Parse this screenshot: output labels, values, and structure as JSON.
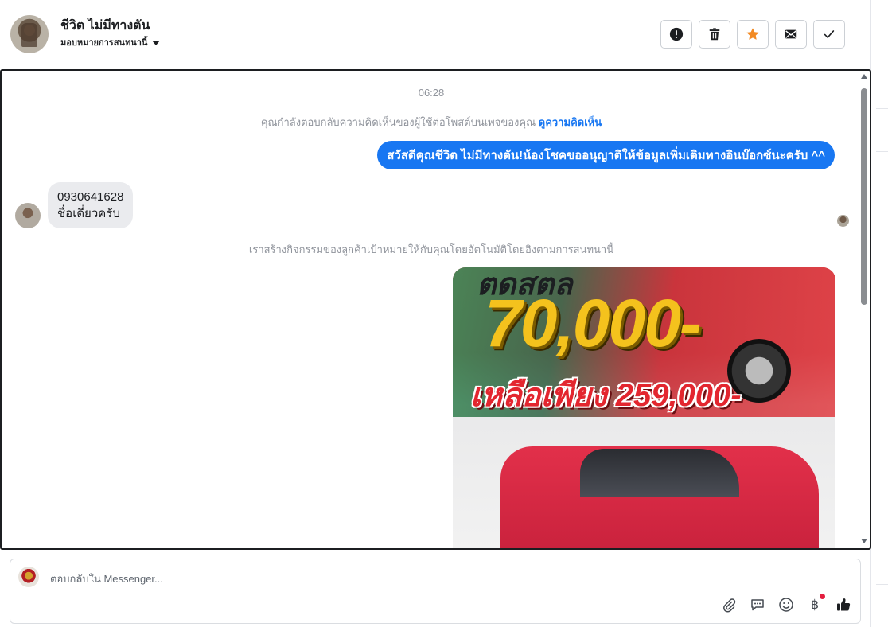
{
  "header": {
    "contact_name": "ชีวิต ไม่มีทางตัน",
    "assign_label": "มอบหมายการสนทนานี้",
    "actions": [
      {
        "name": "spam",
        "icon": "alert-circle-icon"
      },
      {
        "name": "delete",
        "icon": "trash-icon"
      },
      {
        "name": "star",
        "icon": "star-icon",
        "color": "#f28a24"
      },
      {
        "name": "mark-unread",
        "icon": "envelope-icon"
      },
      {
        "name": "done",
        "icon": "check-icon"
      }
    ]
  },
  "conversation": {
    "timestamp": "06:28",
    "system_reply_text": "คุณกำลังตอบกลับความคิดเห็นของผู้ใช้ต่อโพสต์บนเพจของคุณ",
    "system_reply_link": "ดูความคิดเห็น",
    "outgoing_message": "สวัสดีคุณชีวิต ไม่มีทางตัน!น้องโชคขออนุญาติให้ข้อมูลเพิ่มเติมทางอินบ๊อกซ์นะครับ ^^",
    "incoming_line1": "0930641628",
    "incoming_line2": "ชื่อเดี่ยวครับ",
    "system_activity_text": "เราสร้างกิจกรรมของลูกค้าเป้าหมายให้กับคุณโดยอัตโนมัติโดยอิงตามการสนทนานี้",
    "promo": {
      "top_text": "ตดสตล",
      "big_text": "70,000-",
      "sub_text": "เหลือเพียง 259,000-"
    }
  },
  "composer": {
    "placeholder": "ตอบกลับใน Messenger...",
    "currency_glyph": "฿"
  },
  "colors": {
    "accent": "#1877f2",
    "star": "#f28a24",
    "notification_dot": "#e41e3f"
  }
}
